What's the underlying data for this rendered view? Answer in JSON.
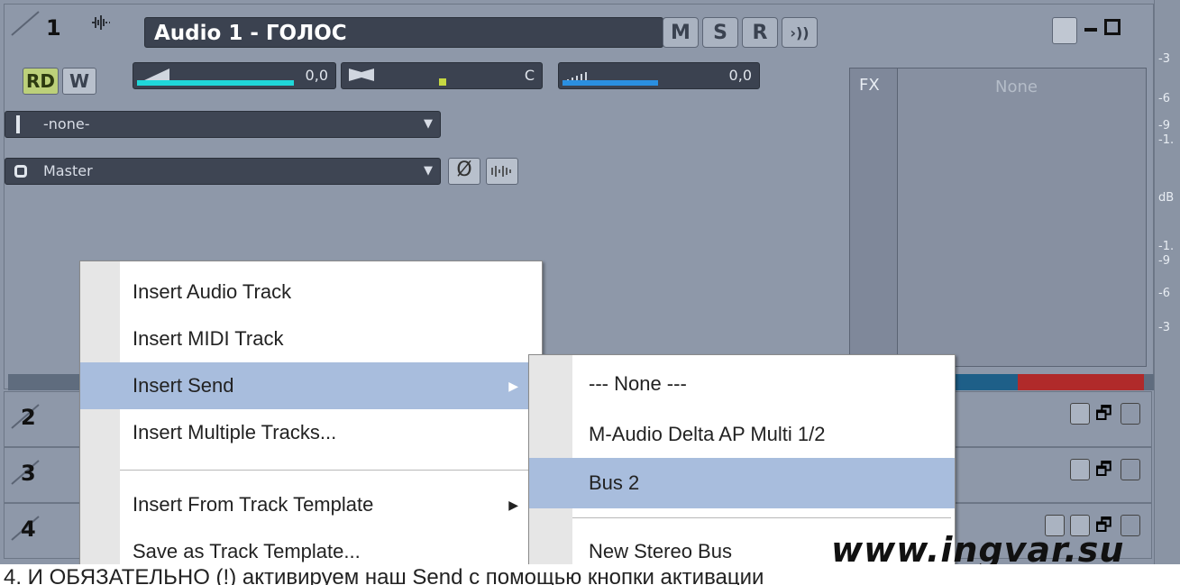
{
  "track1": {
    "number": "1",
    "name": "Audio 1 - ГОЛОС",
    "buttons": {
      "mute": "M",
      "solo": "S",
      "record": "R",
      "monitor": "›))"
    },
    "rd": "RD",
    "w": "W",
    "volume": "0,0",
    "pan": "C",
    "width": "0,0",
    "input_select": "-none-",
    "output_select": "Master",
    "fx_label": "FX",
    "fx_slot": "None"
  },
  "tracks": [
    {
      "number": "2"
    },
    {
      "number": "3"
    },
    {
      "number": "4"
    }
  ],
  "vu_scale": [
    "-3",
    "-6",
    "-9",
    "-1.",
    "dB",
    "-1.",
    "-9",
    "-6",
    "-3"
  ],
  "context_menu": {
    "items": [
      {
        "label": "Insert Audio Track"
      },
      {
        "label": "Insert MIDI Track"
      },
      {
        "label": "Insert Send",
        "arrow": "▶"
      },
      {
        "label": "Insert Multiple Tracks..."
      },
      {
        "label": "Insert From Track Template",
        "arrow": "▶"
      },
      {
        "label": "Save as Track Template..."
      }
    ]
  },
  "send_submenu": {
    "items": [
      {
        "label": "--- None ---"
      },
      {
        "label": "M-Audio Delta AP Multi 1/2"
      },
      {
        "label": "Bus 2"
      },
      {
        "label": "New Stereo Bus"
      }
    ]
  },
  "watermark": "www.ingvar.su",
  "caption": "4. И ОБЯЗАТЕЛЬНО (!) активируем наш Send с помощью кнопки активации"
}
